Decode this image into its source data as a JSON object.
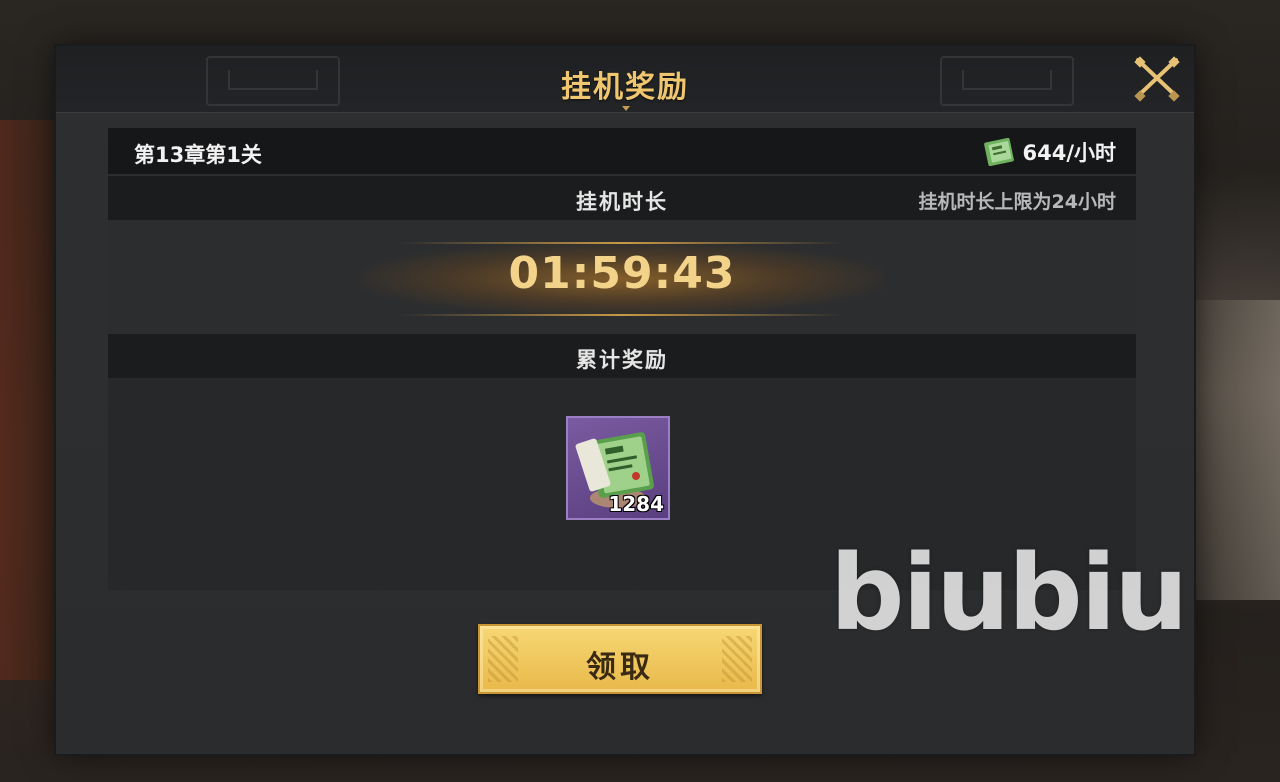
{
  "header": {
    "title": "挂机奖励"
  },
  "info": {
    "stage": "第13章第1关",
    "rate": "644/小时"
  },
  "duration": {
    "title": "挂机时长",
    "note": "挂机时长上限为24小时",
    "timer": "01:59:43"
  },
  "reward": {
    "title": "累计奖励",
    "item_count": "1284",
    "item_icon": "green-book-icon"
  },
  "actions": {
    "claim_label": "领取"
  },
  "watermark": "biubiu",
  "colors": {
    "title_gold": "#f0c76e",
    "timer_gold": "#f3d38a",
    "button_gold": "#f7d774",
    "item_purple": "#6a4a90"
  }
}
